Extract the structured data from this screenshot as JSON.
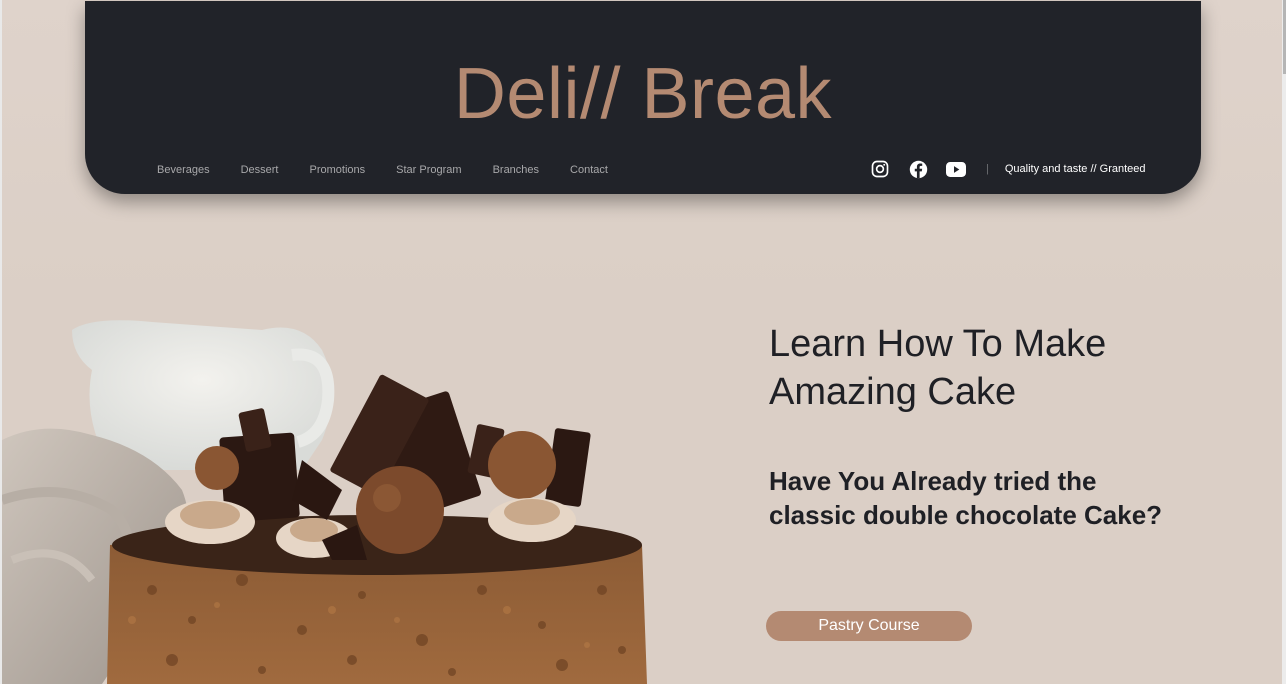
{
  "header": {
    "brand": "Deli// Break",
    "nav": [
      {
        "label": "Beverages"
      },
      {
        "label": "Dessert"
      },
      {
        "label": "Promotions"
      },
      {
        "label": "Star Program"
      },
      {
        "label": "Branches"
      },
      {
        "label": "Contact"
      }
    ],
    "social": [
      {
        "icon": "instagram-icon"
      },
      {
        "icon": "facebook-icon"
      },
      {
        "icon": "youtube-icon"
      }
    ],
    "separator": "|",
    "tagline": "Quality and taste // Granteed"
  },
  "hero": {
    "title": "Learn How To Make Amazing Cake",
    "subtitle": "Have You Already tried the classic double chocolate Cake?",
    "cta_label": "Pastry Course"
  },
  "colors": {
    "header_bg": "#212329",
    "accent": "#b48a72",
    "page_bg": "#dbcfc6",
    "text_dark": "#1f2025"
  }
}
